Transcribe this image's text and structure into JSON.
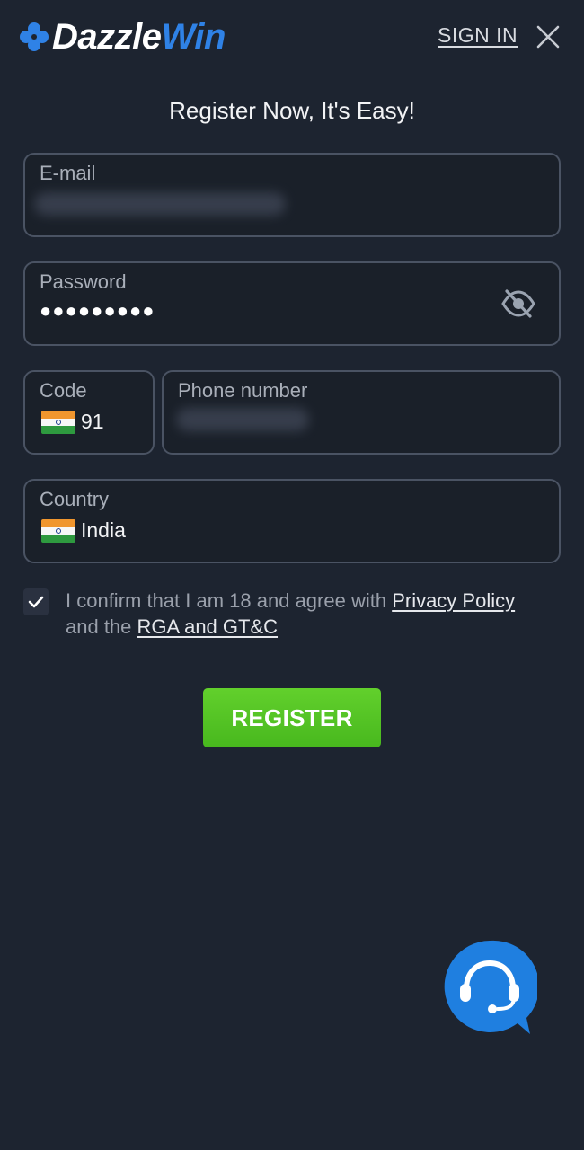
{
  "header": {
    "logo_part1": "Dazzle",
    "logo_part2": "Win",
    "signin_label": "SIGN IN"
  },
  "title": "Register Now, It's Easy!",
  "form": {
    "email": {
      "label": "E-mail"
    },
    "password": {
      "label": "Password",
      "value": "●●●●●●●●●"
    },
    "code": {
      "label": "Code",
      "value": "91"
    },
    "phone": {
      "label": "Phone number"
    },
    "country": {
      "label": "Country",
      "value": "India"
    }
  },
  "consent": {
    "checked": true,
    "text_before": "I confirm that I am 18 and agree with ",
    "privacy_link": "Privacy Policy",
    "text_middle": " and the ",
    "rga_link": "RGA and GT&C"
  },
  "register_label": "REGISTER",
  "colors": {
    "background": "#1d2430",
    "accent_blue": "#2f82e6",
    "register_green": "#55c424",
    "field_border": "#4a5363"
  },
  "icons": {
    "logo": "clover-icon",
    "close": "close-icon",
    "password_toggle": "eye-off-icon",
    "check": "check-icon",
    "support": "headset-chat-icon"
  }
}
